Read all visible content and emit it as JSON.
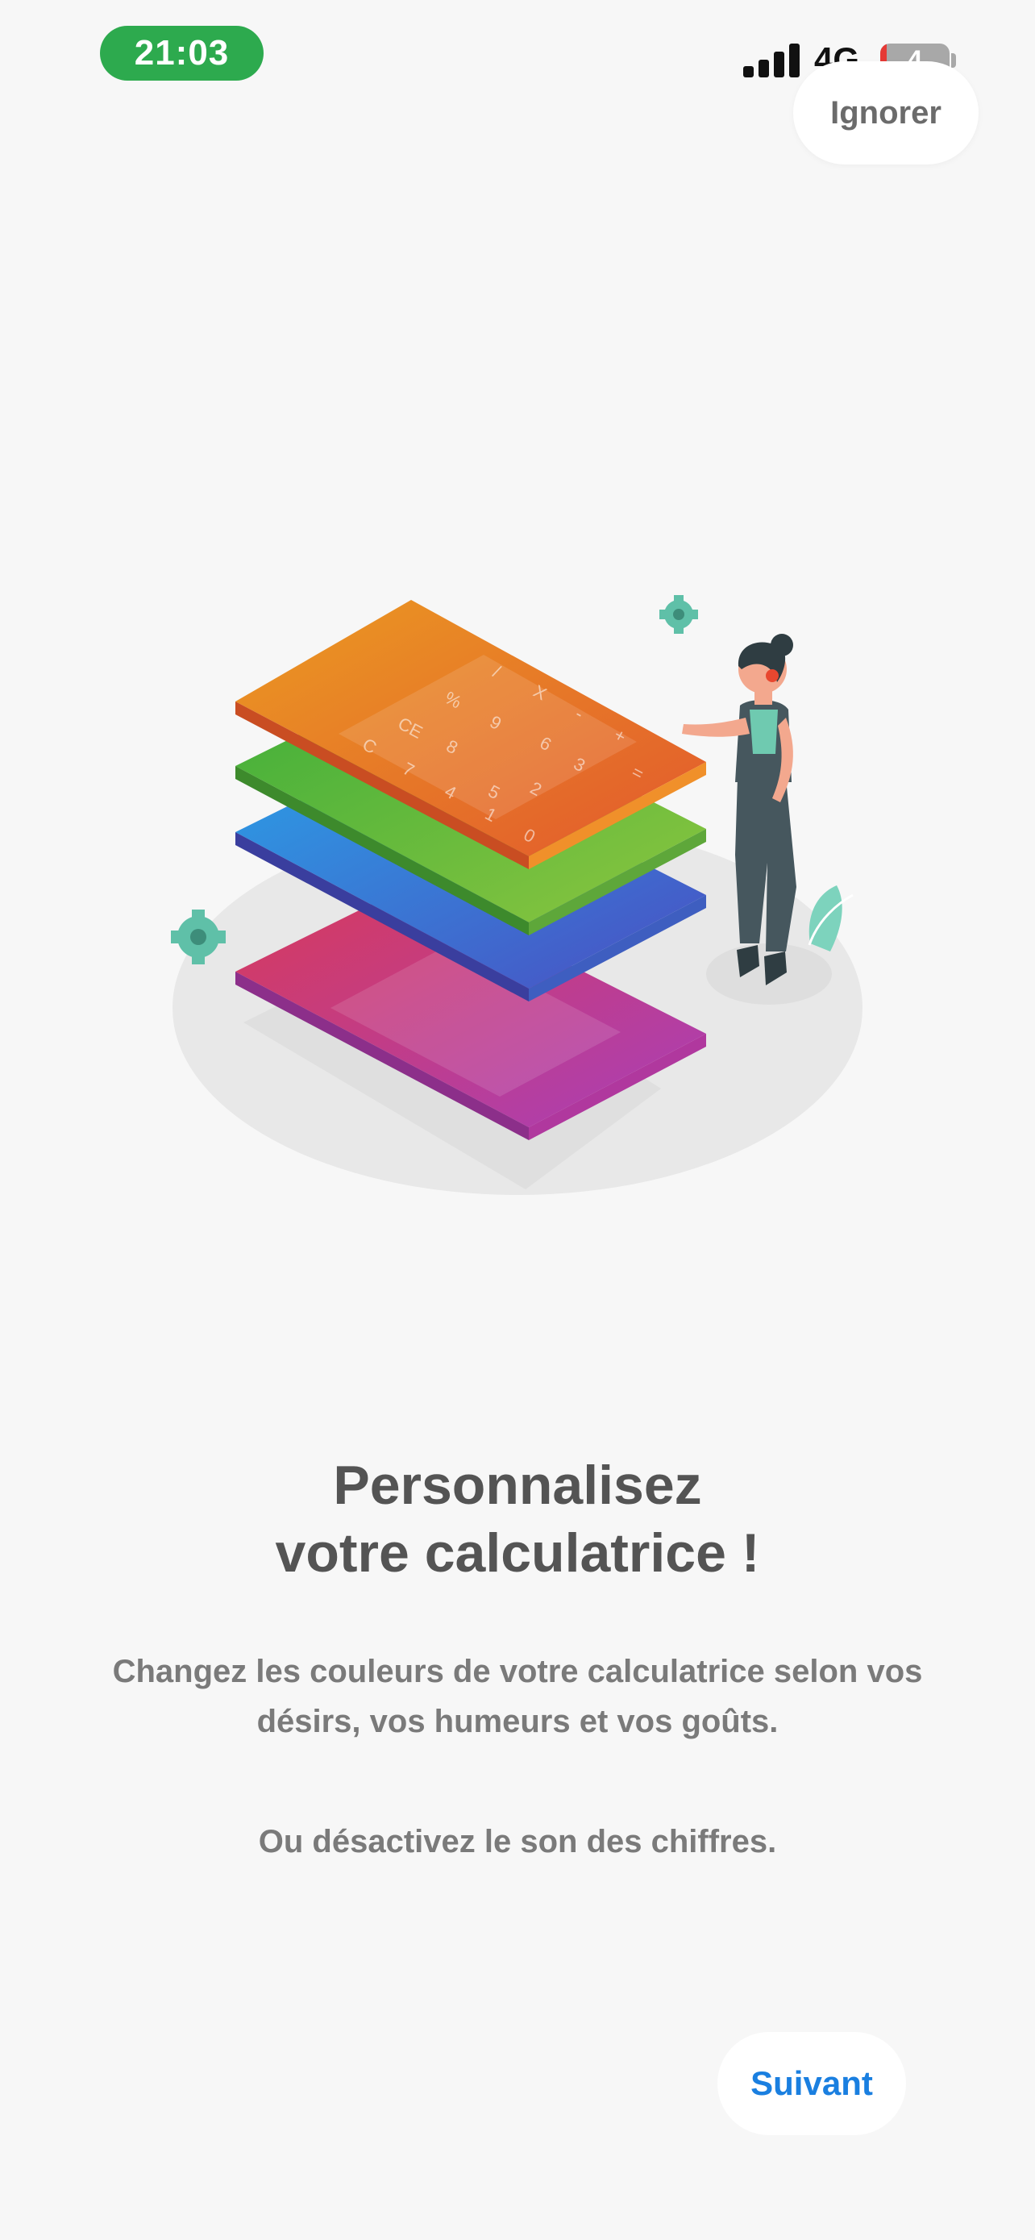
{
  "status_bar": {
    "time": "21:03",
    "network": "4G",
    "battery_level": "4"
  },
  "header": {
    "skip_label": "Ignorer"
  },
  "illustration": {
    "layer_colors": [
      "#c9378a",
      "#3d6fd0",
      "#5cb33a",
      "#e8772b"
    ],
    "keypad_labels": [
      "C",
      "CE",
      "%",
      "/",
      "X",
      "7",
      "8",
      "9",
      "-",
      "+",
      "4",
      "5",
      "6",
      "1",
      "2",
      "3",
      "=",
      "0",
      "."
    ]
  },
  "content": {
    "title_line1": "Personnalisez",
    "title_line2": "votre calculatrice !",
    "description": "Changez les couleurs de votre calculatrice selon vos désirs, vos humeurs et vos goûts.",
    "description_secondary": "Ou désactivez le son des chiffres."
  },
  "footer": {
    "next_label": "Suivant"
  },
  "colors": {
    "accent": "#1a7fe0",
    "time_pill": "#2daa4e",
    "background": "#f7f7f7"
  }
}
